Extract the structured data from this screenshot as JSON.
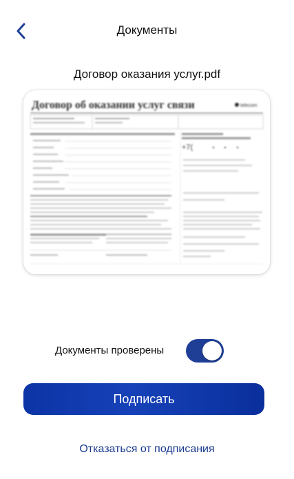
{
  "header": {
    "title": "Документы"
  },
  "document": {
    "file_name": "Договор оказания услуг.pdf",
    "preview": {
      "heading": "Договор об оказании услуг связи",
      "brand": "telecom",
      "phone_prefix": "+7("
    }
  },
  "verify": {
    "label": "Документы проверены",
    "checked": true
  },
  "actions": {
    "sign_label": "Подписать",
    "decline_label": "Отказаться от подписания"
  },
  "colors": {
    "accent": "#1f3f97",
    "button": "#0c34a6",
    "link": "#1a3a8f"
  }
}
